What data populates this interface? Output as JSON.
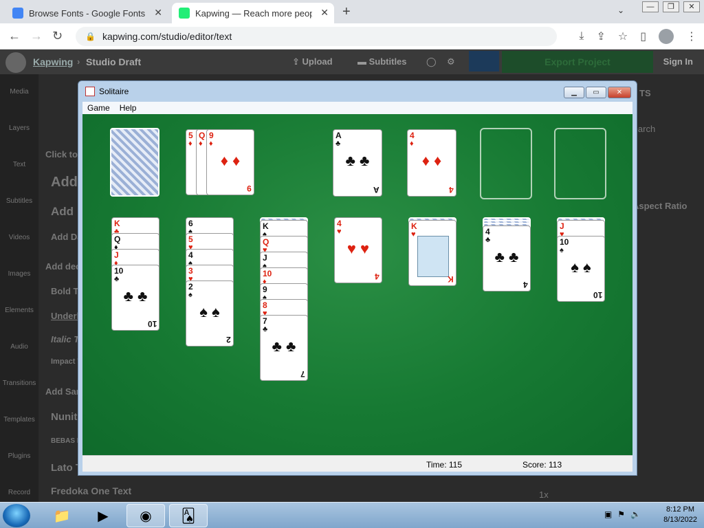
{
  "browser": {
    "tabs": [
      {
        "title": "Browse Fonts - Google Fonts",
        "active": false
      },
      {
        "title": "Kapwing — Reach more people v",
        "active": true
      }
    ],
    "new_tab": "+",
    "menu": "⌄",
    "url": "kapwing.com/studio/editor/text",
    "min": "—",
    "restore": "❐",
    "close": "✕"
  },
  "kapwing": {
    "brand": "Kapwing",
    "sep": "›",
    "draft": "Studio Draft",
    "upload": "Upload",
    "subtitles": "Subtitles",
    "export": "Export Project",
    "signin": "Sign In",
    "sidebar": [
      "Media",
      "Layers",
      "Text",
      "Subtitles",
      "Videos",
      "Images",
      "Elements",
      "Audio",
      "Transitions",
      "Templates",
      "Plugins",
      "Record"
    ],
    "texts": [
      "Click to",
      "Add",
      "Add",
      "Add Da",
      "Add dec",
      "Bold T",
      "Underl",
      "Italic T",
      "Impact T",
      "Add Sar",
      "Nunit",
      "BEBAS N",
      "Lato T",
      "Fredoka One Text"
    ],
    "right_texts": [
      "TS",
      "Search",
      "Aspect Ratio",
      "1x"
    ]
  },
  "solitaire": {
    "title": "Solitaire",
    "menu": [
      "Game",
      "Help"
    ],
    "status_time": "Time:  115",
    "status_score": "Score: 113",
    "colors": {
      "felt": "#177a33",
      "red": "#d21",
      "black": "#111"
    },
    "waste": [
      {
        "rank": "5",
        "suit": "♦",
        "color": "red"
      },
      {
        "rank": "Q",
        "suit": "♦",
        "color": "red"
      },
      {
        "rank": "9",
        "suit": "♦",
        "color": "red"
      }
    ],
    "foundations": [
      {
        "rank": "A",
        "suit": "♣",
        "color": "black"
      },
      {
        "rank": "4",
        "suit": "♦",
        "color": "red"
      },
      null,
      null
    ],
    "tableau": [
      [
        {
          "rank": "K",
          "suit": "♣",
          "color": "red"
        },
        {
          "rank": "Q",
          "suit": "♦",
          "color": "black"
        },
        {
          "rank": "J",
          "suit": "♦",
          "color": "red"
        },
        {
          "rank": "10",
          "suit": "♣",
          "color": "black"
        }
      ],
      [
        {
          "rank": "6",
          "suit": "♠",
          "color": "black"
        },
        {
          "rank": "5",
          "suit": "♥",
          "color": "red"
        },
        {
          "rank": "4",
          "suit": "♠",
          "color": "black"
        },
        {
          "rank": "3",
          "suit": "♥",
          "color": "red"
        },
        {
          "rank": "2",
          "suit": "♠",
          "color": "black"
        }
      ],
      [
        {
          "rank": "K",
          "suit": "♠",
          "color": "black"
        },
        {
          "rank": "Q",
          "suit": "♥",
          "color": "red"
        },
        {
          "rank": "J",
          "suit": "♠",
          "color": "black"
        },
        {
          "rank": "10",
          "suit": "♦",
          "color": "red"
        },
        {
          "rank": "9",
          "suit": "♠",
          "color": "black"
        },
        {
          "rank": "8",
          "suit": "♥",
          "color": "red"
        },
        {
          "rank": "7",
          "suit": "♣",
          "color": "black"
        }
      ],
      [
        {
          "rank": "4",
          "suit": "♥",
          "color": "red"
        }
      ],
      [
        {
          "rank": "K",
          "suit": "♥",
          "color": "red"
        }
      ],
      [
        {
          "rank": "4",
          "suit": "♣",
          "color": "black"
        }
      ],
      [
        {
          "rank": "J",
          "suit": "♥",
          "color": "red"
        },
        {
          "rank": "10",
          "suit": "♠",
          "color": "black"
        }
      ]
    ],
    "hidden_counts": [
      0,
      0,
      1,
      0,
      1,
      3,
      1
    ]
  },
  "taskbar": {
    "time": "8:12 PM",
    "date": "8/13/2022"
  }
}
